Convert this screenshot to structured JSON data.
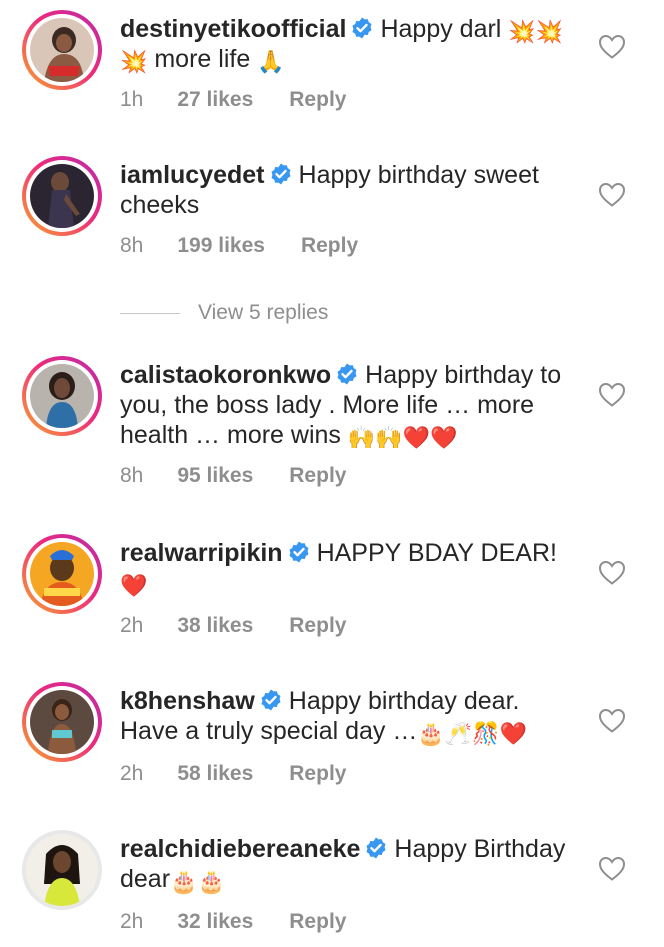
{
  "view_replies_label": "View 5 replies",
  "colors": {
    "text": "#262626",
    "muted": "#8e8e8e",
    "verified": "#3897f0",
    "heart_red": "#e0242e"
  },
  "comments": [
    {
      "username": "destinyetikoofficial",
      "verified": true,
      "text": "Happy darl",
      "emoji_after_text": "💥💥",
      "second_line_emoji": "💥",
      "second_line_text": "more life",
      "end_emoji": "🙏",
      "time": "1h",
      "likes": "27 likes",
      "reply": "Reply"
    },
    {
      "username": "iamlucyedet",
      "verified": true,
      "text": "Happy birthday sweet cheeks",
      "time": "8h",
      "likes": "199 likes",
      "reply": "Reply"
    },
    {
      "username": "calistaokoronkwo",
      "verified": true,
      "text": "Happy birthday to you, the boss lady . More life … more health … more wins",
      "emoji": "🙌🙌❤️❤️",
      "time": "8h",
      "likes": "95 likes",
      "reply": "Reply"
    },
    {
      "username": "realwarripikin",
      "verified": true,
      "text": "HAPPY BDAY DEAR!",
      "emoji": "❤️",
      "time": "2h",
      "likes": "38 likes",
      "reply": "Reply"
    },
    {
      "username": "k8henshaw",
      "verified": true,
      "text": "Happy birthday dear. Have a truly special day …",
      "emoji": "🎂🥂🎊❤️",
      "time": "2h",
      "likes": "58 likes",
      "reply": "Reply"
    },
    {
      "username": "realchidiebereaneke",
      "verified": true,
      "text": "Happy Birthday dear",
      "emoji": "🎂🎂",
      "time": "2h",
      "likes": "32 likes",
      "reply": "Reply"
    }
  ]
}
